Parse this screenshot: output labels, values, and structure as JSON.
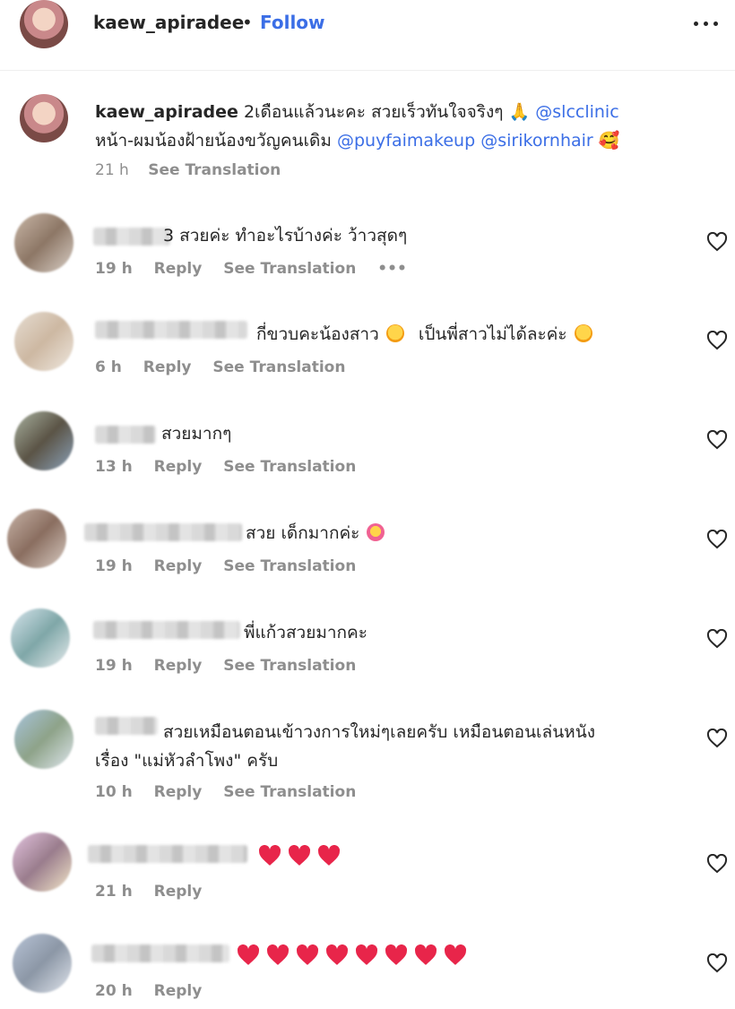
{
  "header": {
    "username": "kaew_apiradee",
    "separator": "•",
    "follow_label": "Follow",
    "more_icon": "more-horizontal-icon"
  },
  "caption": {
    "username": "kaew_apiradee",
    "line1_text": "2เดือนแล้วนะคะ สวยเร็วทันใจจริงๆ",
    "line1_emoji": "🙏",
    "mention1": "@slcclinic",
    "line2_text": "หน้า-ผมน้องฝ้ายน้องขวัญคนเดิม",
    "mention2": "@puyfaimakeup",
    "mention3": "@sirikornhair",
    "line2_emoji": "🥰",
    "time": "21 h",
    "see_translation": "See Translation"
  },
  "comments": [
    {
      "text": "3 สวยค่ะ ทำอะไรบ้างค่ะ ว้าวสุดๆ",
      "time": "19 h",
      "reply": "Reply",
      "see_translation": "See Translation",
      "more": "•••"
    },
    {
      "text": "กี่ขวบคะน้องสาว",
      "text2": "เป็นพี่สาวไม่ได้ละค่ะ",
      "time": "6 h",
      "reply": "Reply",
      "see_translation": "See Translation"
    },
    {
      "text": "สวยมากๆ",
      "time": "13 h",
      "reply": "Reply",
      "see_translation": "See Translation"
    },
    {
      "text": "สวย เด็กมากค่ะ",
      "time": "19 h",
      "reply": "Reply",
      "see_translation": "See Translation"
    },
    {
      "text": "พี่แก้วสวยมากคะ",
      "time": "19 h",
      "reply": "Reply",
      "see_translation": "See Translation"
    },
    {
      "text": "สวยเหมือนตอนเข้าวงการใหม่ๆเลยครับ เหมือนตอนเล่นหนัง",
      "text_line2": "เรื่อง \"แม่หัวลำโพง\" ครับ",
      "time": "10 h",
      "reply": "Reply",
      "see_translation": "See Translation"
    },
    {
      "hearts": 3,
      "time": "21 h",
      "reply": "Reply"
    },
    {
      "hearts": 8,
      "time": "20 h",
      "reply": "Reply"
    }
  ],
  "colors": {
    "link": "#3b6ee6",
    "heart": "#e8254a",
    "meta": "#8e8e8e"
  }
}
